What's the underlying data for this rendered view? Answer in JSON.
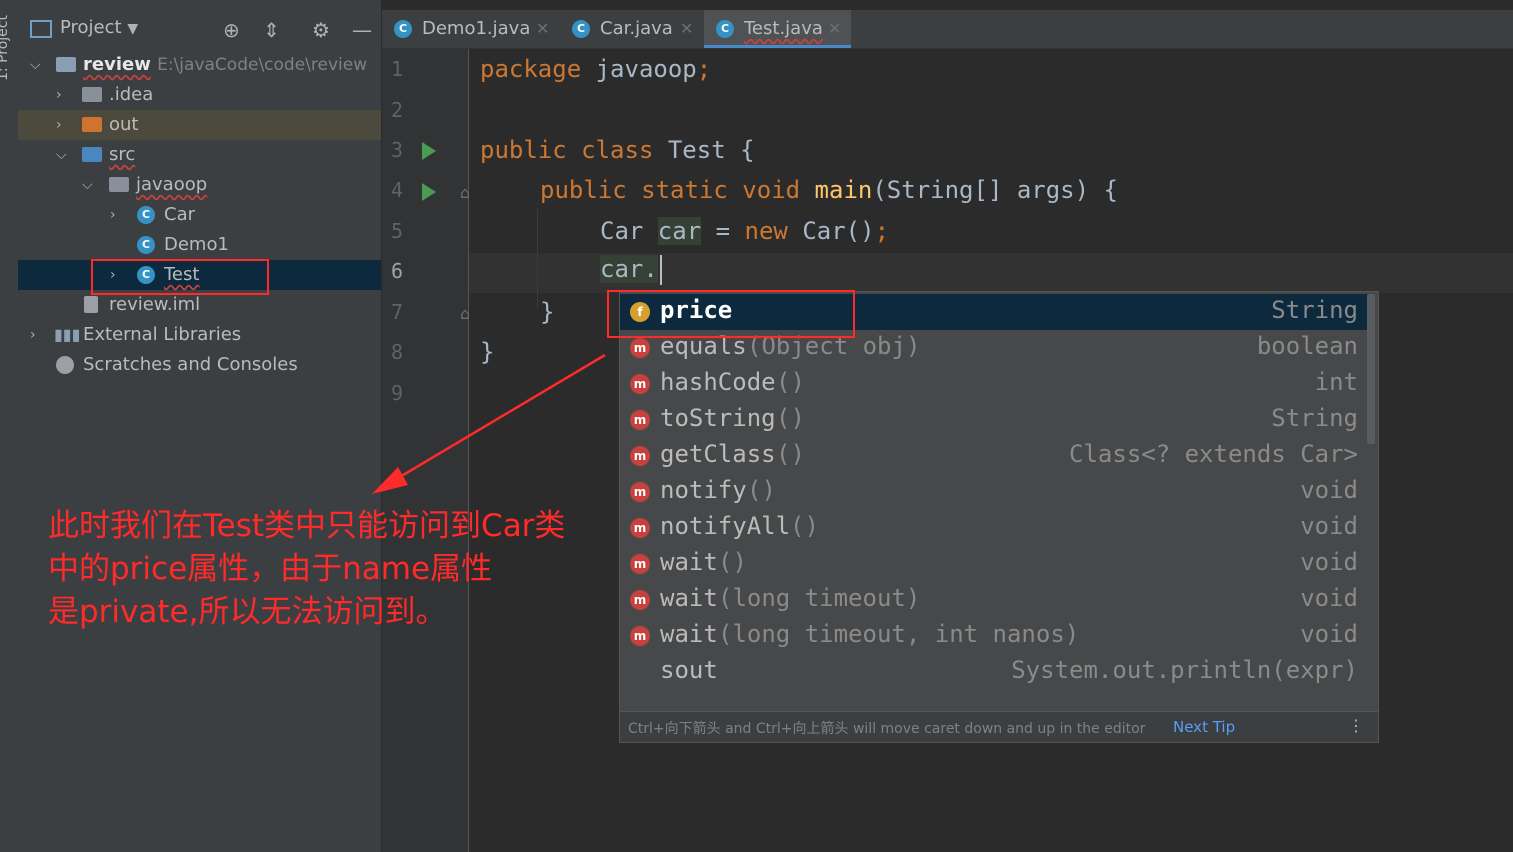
{
  "side_strip": {
    "label": "1: Project"
  },
  "project": {
    "title": "Project",
    "tree": {
      "root": {
        "name": "review",
        "path": "E:\\javaCode\\code\\review"
      },
      "idea": ".idea",
      "out": "out",
      "src": "src",
      "pkg": "javaoop",
      "car": "Car",
      "demo1": "Demo1",
      "test": "Test",
      "iml": "review.iml",
      "ext": "External Libraries",
      "scratch": "Scratches and Consoles"
    }
  },
  "tabs": [
    {
      "label": "Demo1.java"
    },
    {
      "label": "Car.java"
    },
    {
      "label": "Test.java"
    }
  ],
  "gutter": {
    "lines": [
      "1",
      "2",
      "3",
      "4",
      "5",
      "6",
      "7",
      "8",
      "9"
    ]
  },
  "code": {
    "l1_kw": "package",
    "l1_rest": " javaoop",
    "l1_semi": ";",
    "l3_kw": "public class",
    "l3_rest": " Test {",
    "l4_kw": "public static void",
    "l4_fn": "main",
    "l4_rest": "(String[] args) {",
    "l5_a": "Car ",
    "l5_var": "car",
    "l5_b": " = ",
    "l5_kw": "new",
    "l5_c": " Car()",
    "l5_semi": ";",
    "l6": "car.",
    "l7": "}",
    "l8": "}"
  },
  "completion": {
    "items": [
      {
        "kind": "f",
        "name": "price",
        "params": "",
        "type": "String"
      },
      {
        "kind": "m",
        "name": "equals",
        "params": "(Object obj)",
        "type": "boolean"
      },
      {
        "kind": "m",
        "name": "hashCode",
        "params": "()",
        "type": "int"
      },
      {
        "kind": "m",
        "name": "toString",
        "params": "()",
        "type": "String"
      },
      {
        "kind": "m",
        "name": "getClass",
        "params": "()",
        "type": "Class<? extends Car>"
      },
      {
        "kind": "m",
        "name": "notify",
        "params": "()",
        "type": "void"
      },
      {
        "kind": "m",
        "name": "notifyAll",
        "params": "()",
        "type": "void"
      },
      {
        "kind": "m",
        "name": "wait",
        "params": "()",
        "type": "void"
      },
      {
        "kind": "m",
        "name": "wait",
        "params": "(long timeout)",
        "type": "void"
      },
      {
        "kind": "m",
        "name": "wait",
        "params": "(long timeout, int nanos)",
        "type": "void"
      },
      {
        "kind": "",
        "name": "sout",
        "params": "",
        "type": "System.out.println(expr)"
      }
    ],
    "footer_tip": "Ctrl+向下箭头 and Ctrl+向上箭头 will move caret down and up in the editor",
    "next_tip": "Next Tip"
  },
  "annotation": {
    "line1": "此时我们在Test类中只能访问到Car类",
    "line2": "中的price属性，由于name属性",
    "line3": "是private,所以无法访问到。"
  }
}
